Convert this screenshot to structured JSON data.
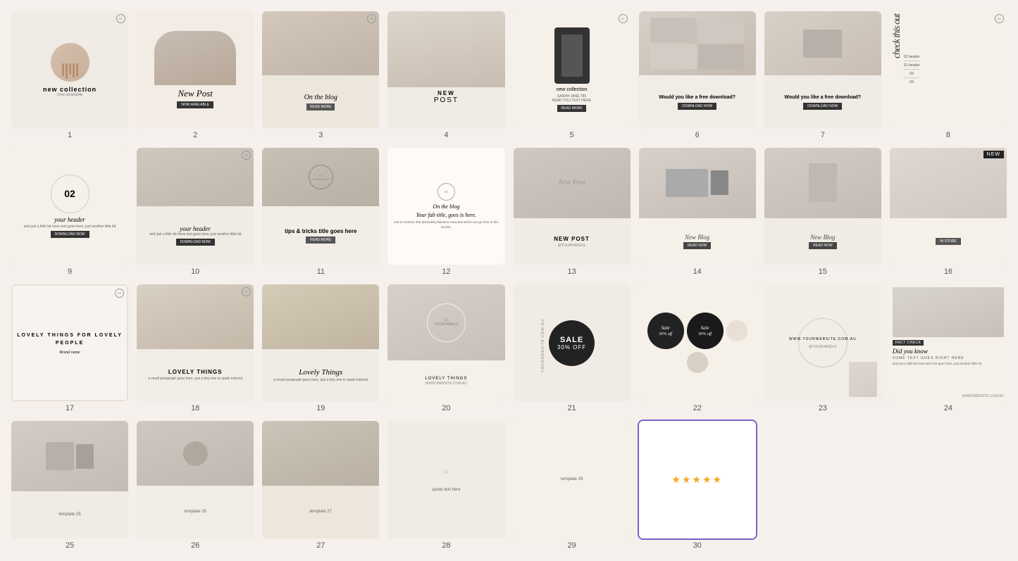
{
  "grid": {
    "columns": 8,
    "gap": 12
  },
  "cards": [
    {
      "id": 1,
      "num": "1",
      "type": "new-collection",
      "bg": "#f0ebe4",
      "title": "new collection",
      "subtitle": "now available",
      "selected": false
    },
    {
      "id": 2,
      "num": "2",
      "type": "new-post",
      "bg": "#f2ece4",
      "title": "New Post",
      "subtitle": "NOW AVAILABLE",
      "selected": false
    },
    {
      "id": 3,
      "num": "3",
      "type": "on-the-blog",
      "bg": "#ede6dc",
      "title": "On the blog",
      "btn": "READ MORE",
      "selected": false
    },
    {
      "id": 4,
      "num": "4",
      "type": "new-post-2",
      "bg": "#f0ebe4",
      "title": "NEW",
      "subtitle": "POST",
      "selected": false
    },
    {
      "id": 5,
      "num": "5",
      "type": "new-collection-2",
      "bg": "#f5f0e8",
      "title": "new collection",
      "btn": "READ MORE",
      "selected": false
    },
    {
      "id": 6,
      "num": "6",
      "type": "free-download",
      "bg": "#f2ece6",
      "title": "Would you like a free download?",
      "btn": "DOWNLOAD NOW",
      "selected": false
    },
    {
      "id": 7,
      "num": "7",
      "type": "free-download-2",
      "bg": "#f0ebe4",
      "title": "Would you like a free download?",
      "btn": "DOWNLOAD NOW",
      "selected": false
    },
    {
      "id": 8,
      "num": "8",
      "type": "check-this-out",
      "bg": "#f5f0e8",
      "title": "check this out",
      "headers": [
        "01 header",
        "02 header",
        "03",
        "04"
      ],
      "selected": false
    },
    {
      "id": 9,
      "num": "9",
      "type": "header-02",
      "bg": "#f5f0e8",
      "number": "02",
      "title": "your header",
      "sub": "and just a little bit more text goes here, just another little bit",
      "btn": "DOWNLOAD NOW",
      "selected": false
    },
    {
      "id": 10,
      "num": "10",
      "type": "your-header",
      "bg": "#f0ebe4",
      "title": "your header",
      "sub": "and just a little bit more text goes here, just another little bit",
      "btn": "DOWNLOAD NOW",
      "selected": false
    },
    {
      "id": 11,
      "num": "11",
      "type": "tips-tricks",
      "bg": "#f2ede6",
      "title": "tips & tricks title goes here",
      "btn": "READ MORE",
      "selected": false
    },
    {
      "id": 12,
      "num": "12",
      "type": "on-the-blog-2",
      "bg": "#fdfaf7",
      "title": "On the blog",
      "subtitle": "Your fab title, goes is here.",
      "text": "Not to mention that absolutely fabulous extra text which can go here in this section.",
      "selected": false
    },
    {
      "id": 13,
      "num": "13",
      "type": "new-post-3",
      "bg": "#f0ebe4",
      "title": "New Post",
      "subtitle": "NEW POST",
      "handle": "@YOURHANDLE",
      "selected": false
    },
    {
      "id": 14,
      "num": "14",
      "type": "new-blog",
      "bg": "#f5f0e8",
      "title": "New Blog",
      "btn": "READ NOW",
      "selected": false
    },
    {
      "id": 15,
      "num": "15",
      "type": "new-blog-2",
      "bg": "#f0ebe4",
      "title": "New Blog",
      "btn": "READ NOW",
      "selected": false
    },
    {
      "id": 16,
      "num": "16",
      "type": "new-store",
      "bg": "#f5f0e8",
      "title": "NEW",
      "btn": "IN STORE",
      "selected": false
    },
    {
      "id": 17,
      "num": "17",
      "type": "lovely-things",
      "bg": "#f7f3ee",
      "title": "LOVELY THINGS FOR LOVELY PEOPLE",
      "brand": "Brand name",
      "selected": false
    },
    {
      "id": 18,
      "num": "18",
      "type": "lovely-things-2",
      "bg": "#f2ece6",
      "title": "LOVELY THINGS",
      "sub": "a small paragraph goes here, just a tiny one to spark interest",
      "selected": false
    },
    {
      "id": 19,
      "num": "19",
      "type": "lovely-things-3",
      "bg": "#f0ebe4",
      "title": "Lovely Things",
      "sub": "a small paragraph goes here, just a tiny one to spark interest",
      "selected": false
    },
    {
      "id": 20,
      "num": "20",
      "type": "lovely-things-4",
      "bg": "#f5f0e8",
      "title": "LOVELY THINGS",
      "website": "WWW.WEBSITE.COM.AU",
      "selected": false
    },
    {
      "id": 21,
      "num": "21",
      "type": "sale",
      "bg": "#f0ebe4",
      "title": "SALE",
      "discount": "30% OFF",
      "selected": false
    },
    {
      "id": 22,
      "num": "22",
      "type": "sale-circles",
      "bg": "#f5f0e8",
      "sale1": "Sale 30% off",
      "sale2": "Sale 30% off",
      "selected": false
    },
    {
      "id": 23,
      "num": "23",
      "type": "website",
      "bg": "#f2ede6",
      "website": "WWW.YOURWEBSITE.COM.AU",
      "handle": "@YOURHANDLE",
      "selected": false
    },
    {
      "id": 24,
      "num": "24",
      "type": "did-you-know",
      "bg": "#f5f0e8",
      "tag": "FACT CHECK",
      "title": "Did you know",
      "sub": "SOME TEXT GOES RIGHT HERE",
      "text": "and just a little bit more text font goes here, just another little bit",
      "website": "WWW.WEBSITE.COM.AU",
      "selected": false
    },
    {
      "id": 25,
      "num": "25",
      "type": "placeholder",
      "bg": "#f0ebe4",
      "selected": false
    },
    {
      "id": 26,
      "num": "26",
      "type": "placeholder",
      "bg": "#f2ece6",
      "selected": false
    },
    {
      "id": 27,
      "num": "27",
      "type": "placeholder",
      "bg": "#ede6dc",
      "selected": false
    },
    {
      "id": 28,
      "num": "28",
      "type": "placeholder",
      "bg": "#f0ebe4",
      "selected": false
    },
    {
      "id": 29,
      "num": "29",
      "type": "placeholder",
      "bg": "#f5f0e8",
      "selected": false
    },
    {
      "id": 30,
      "num": "30",
      "type": "stars",
      "bg": "#fff",
      "stars": "★★★★★",
      "selected": true
    }
  ]
}
